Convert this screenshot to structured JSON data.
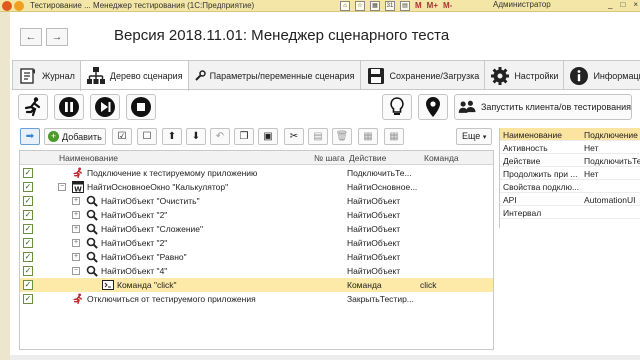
{
  "titlebar": {
    "title": "Тестирование ... Менеджер тестирования (1С:Предприятие)",
    "user": "Администратор",
    "tools": [
      "M",
      "M+",
      "M-"
    ],
    "window_controls": [
      "_",
      "□",
      "×"
    ]
  },
  "nav": {
    "back": "←",
    "forward": "→"
  },
  "form_title": "Версия 2018.11.01: Менеджер сценарного теста",
  "tabs": [
    {
      "label": "Журнал",
      "icon": "journal-icon"
    },
    {
      "label": "Дерево сценария",
      "icon": "tree-icon"
    },
    {
      "label": "Параметры/переменные сценария",
      "icon": "wrench-icon"
    },
    {
      "label": "Сохранение/Загрузка",
      "icon": "floppy-icon"
    },
    {
      "label": "Настройки",
      "icon": "gear-icon"
    },
    {
      "label": "Информация",
      "icon": "info-icon"
    }
  ],
  "toolbar": {
    "launch_label": "Запустить клиента/ов тестирования",
    "add_label": "Добавить",
    "more_label": "Еще"
  },
  "grid": {
    "columns": [
      "Наименование",
      "№ шага",
      "Действие",
      "Команда"
    ],
    "rows": [
      {
        "name": "Подключение к тестируемому приложению",
        "action": "ПодключитьТе...",
        "command": "",
        "level": 0,
        "icon": "runner-icon",
        "expander": "",
        "checked": true,
        "selected": false
      },
      {
        "name": "НайтиОсновноеОкно \"Калькулятор\"",
        "action": "НайтиОсновное...",
        "command": "",
        "level": 0,
        "icon": "window-icon",
        "expander": "−",
        "checked": true,
        "selected": false
      },
      {
        "name": "НайтиОбъект \"Очистить\"",
        "action": "НайтиОбъект",
        "command": "",
        "level": 1,
        "icon": "magnifier-icon",
        "expander": "+",
        "checked": true,
        "selected": false
      },
      {
        "name": "НайтиОбъект \"2\"",
        "action": "НайтиОбъект",
        "command": "",
        "level": 1,
        "icon": "magnifier-icon",
        "expander": "+",
        "checked": true,
        "selected": false
      },
      {
        "name": "НайтиОбъект \"Сложение\"",
        "action": "НайтиОбъект",
        "command": "",
        "level": 1,
        "icon": "magnifier-icon",
        "expander": "+",
        "checked": true,
        "selected": false
      },
      {
        "name": "НайтиОбъект \"2\"",
        "action": "НайтиОбъект",
        "command": "",
        "level": 1,
        "icon": "magnifier-icon",
        "expander": "+",
        "checked": true,
        "selected": false
      },
      {
        "name": "НайтиОбъект \"Равно\"",
        "action": "НайтиОбъект",
        "command": "",
        "level": 1,
        "icon": "magnifier-icon",
        "expander": "+",
        "checked": true,
        "selected": false
      },
      {
        "name": "НайтиОбъект \"4\"",
        "action": "НайтиОбъект",
        "command": "",
        "level": 1,
        "icon": "magnifier-icon",
        "expander": "−",
        "checked": true,
        "selected": false
      },
      {
        "name": "Команда \"click\"",
        "action": "Команда",
        "command": "click",
        "level": 2,
        "icon": "command-icon",
        "expander": "",
        "checked": true,
        "selected": true
      },
      {
        "name": "Отключиться от тестируемого приложения",
        "action": "ЗакрытьТестир...",
        "command": "",
        "level": 0,
        "icon": "runner-icon",
        "expander": "",
        "checked": true,
        "selected": false
      }
    ]
  },
  "props": [
    {
      "key": "Наименование",
      "value": "Подключение к"
    },
    {
      "key": "Активность",
      "value": "Нет"
    },
    {
      "key": "Действие",
      "value": "ПодключитьТе"
    },
    {
      "key": "Продолжить при ...",
      "value": "Нет"
    },
    {
      "key": "Свойства подклю...",
      "value": ""
    },
    {
      "key": "API",
      "value": "AutomationUI"
    },
    {
      "key": "Интервал",
      "value": ""
    }
  ],
  "colors": {
    "accent": "#f3e6a6",
    "selection": "#fde9a8",
    "check": "#2e6b12"
  }
}
